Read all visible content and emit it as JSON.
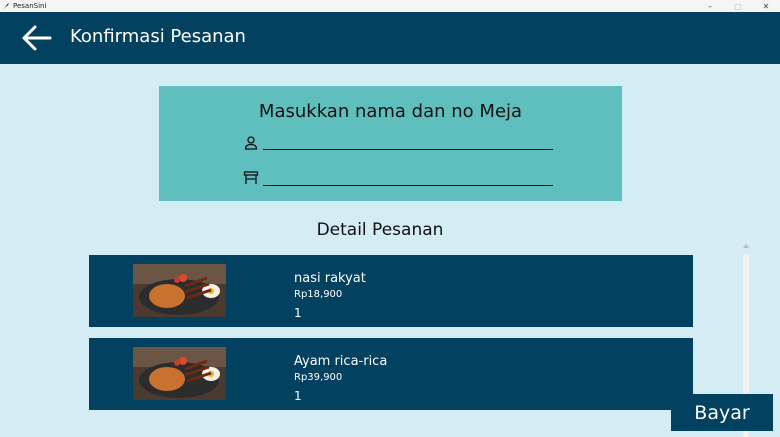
{
  "window": {
    "title": "PesanSini",
    "minimize_glyph": "–",
    "maximize_glyph": "□",
    "close_glyph": "✕"
  },
  "appbar": {
    "back_icon": "arrow-left-icon",
    "title": "Konfirmasi Pesanan"
  },
  "form": {
    "heading": "Masukkan nama dan no Meja",
    "name_icon": "person-icon",
    "name_value": "",
    "table_icon": "table-icon",
    "table_value": ""
  },
  "section_title": "Detail Pesanan",
  "orders": [
    {
      "name": "nasi rakyat",
      "price": "Rp18,900",
      "qty": "1"
    },
    {
      "name": "Ayam rica-rica",
      "price": "Rp39,900",
      "qty": "1"
    }
  ],
  "pay_button": "Bayar",
  "colors": {
    "primary": "#02415f",
    "background": "#d4ecf4",
    "form_card": "#5fbfbe",
    "text_light": "#ffffff"
  }
}
